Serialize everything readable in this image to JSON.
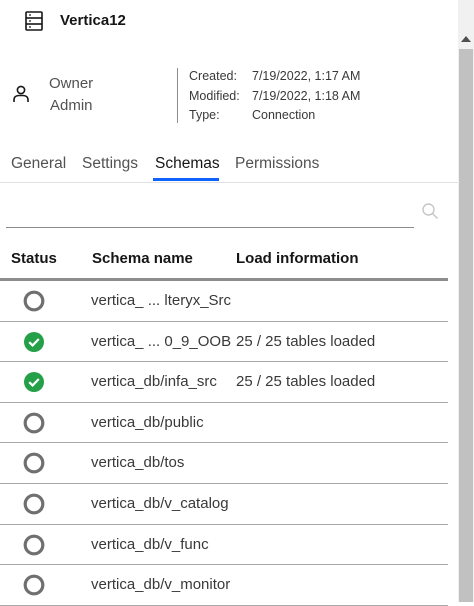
{
  "header": {
    "title": "Vertica12",
    "icon": "database-icon"
  },
  "owner": {
    "label": "Owner",
    "value": "Admin",
    "icon": "user-icon"
  },
  "meta": {
    "created_label": "Created:",
    "created_value": "7/19/2022, 1:17 AM",
    "modified_label": "Modified:",
    "modified_value": "7/19/2022, 1:18 AM",
    "type_label": "Type:",
    "type_value": "Connection"
  },
  "tabs": [
    {
      "label": "General",
      "active": false
    },
    {
      "label": "Settings",
      "active": false
    },
    {
      "label": "Schemas",
      "active": true
    },
    {
      "label": "Permissions",
      "active": false
    }
  ],
  "search": {
    "value": "",
    "placeholder": ""
  },
  "table": {
    "columns": [
      "Status",
      "Schema name",
      "Load information"
    ],
    "rows": [
      {
        "status": "not-loaded",
        "schema": "vertica_ ... lteryx_Src",
        "load": ""
      },
      {
        "status": "loaded",
        "schema": "vertica_ ... 0_9_OOB",
        "load": "25 / 25 tables loaded"
      },
      {
        "status": "loaded",
        "schema": "vertica_db/infa_src",
        "load": "25 / 25 tables loaded"
      },
      {
        "status": "not-loaded",
        "schema": "vertica_db/public",
        "load": ""
      },
      {
        "status": "not-loaded",
        "schema": "vertica_db/tos",
        "load": ""
      },
      {
        "status": "not-loaded",
        "schema": "vertica_db/v_catalog",
        "load": ""
      },
      {
        "status": "not-loaded",
        "schema": "vertica_db/v_func",
        "load": ""
      },
      {
        "status": "not-loaded",
        "schema": "vertica_db/v_monitor",
        "load": ""
      }
    ]
  },
  "colors": {
    "accent": "#0f62fe",
    "success": "#24a148",
    "status_ring": "#6f6f6f"
  }
}
